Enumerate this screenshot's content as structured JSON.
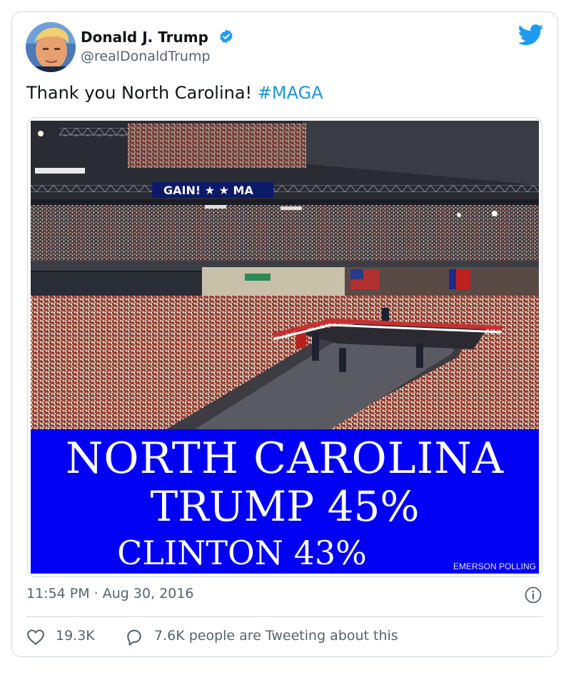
{
  "author": {
    "name": "Donald J. Trump",
    "handle": "@realDonaldTrump",
    "verified": true,
    "avatar_icon": "profile-photo"
  },
  "tweet": {
    "text": "Thank you North Carolina! ",
    "hashtag": "#MAGA"
  },
  "media": {
    "stage_sign": "GAIN! ★ ★ MA",
    "banner_lines": [
      "NORTH CAROLINA",
      "TRUMP 45%",
      "CLINTON 43%"
    ],
    "source_credit": "EMERSON POLLING"
  },
  "meta": {
    "timestamp": "11:54 PM · Aug 30, 2016"
  },
  "actions": {
    "likes": "19.3K",
    "discussion": "7.6K people are Tweeting about this"
  },
  "colors": {
    "brand_blue": "#1d9bf0",
    "hashtag_blue": "#1b95e0",
    "banner_blue": "#0000f4"
  }
}
